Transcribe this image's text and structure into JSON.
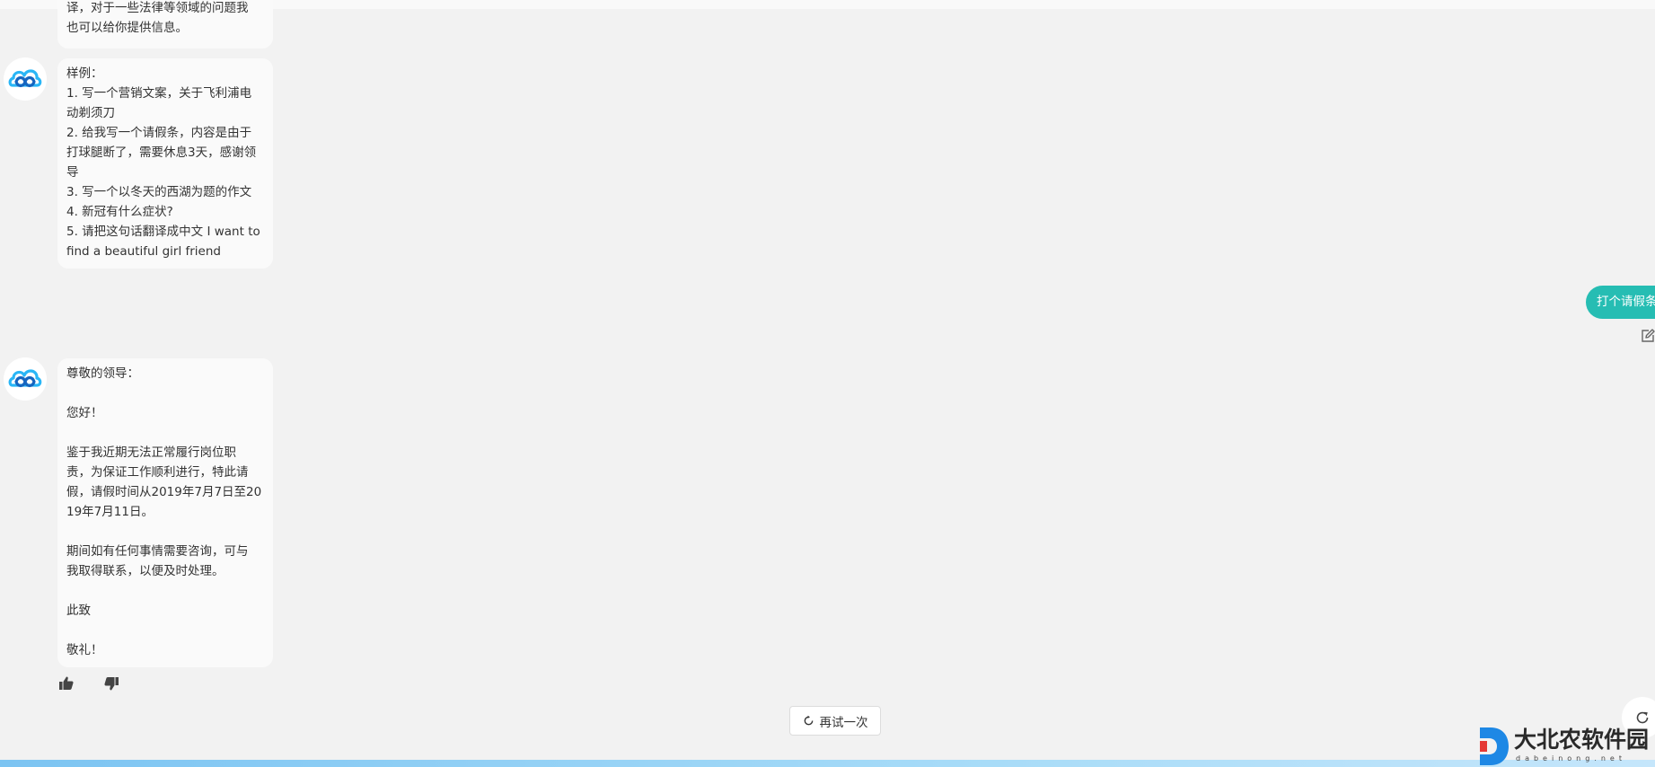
{
  "conversation": {
    "intro_message": {
      "lines": [
        "译，对于一些法律等领域的问题我",
        "也可以给你提供信息。"
      ]
    },
    "examples_message": {
      "lines": [
        "样例：",
        "1. 写一个营销文案，关于飞利浦电",
        "动剃须刀",
        "2. 给我写一个请假条，内容是由于",
        "打球腿断了，需要休息3天，感谢领",
        "导",
        "3. 写一个以冬天的西湖为题的作文",
        "4. 新冠有什么症状?",
        "5. 请把这句话翻译成中文 I want to",
        "find a beautiful girl friend"
      ]
    },
    "user_message": {
      "text": "打个请假条"
    },
    "reply_message": {
      "lines": [
        "尊敬的领导：",
        "",
        "您好！",
        "",
        "鉴于我近期无法正常履行岗位职",
        "责，为保证工作顺利进行，特此请",
        "假，请假时间从2019年7月7日至20",
        "19年7月11日。",
        "",
        "期间如有任何事情需要咨询，可与",
        "我取得联系，以便及时处理。",
        "",
        "此致",
        "",
        "敬礼！"
      ]
    }
  },
  "actions": {
    "retry_label": "再试一次"
  },
  "icons": {
    "avatar": "cloud-logo-icon",
    "like": "thumbs-up-icon",
    "dislike": "thumbs-down-icon",
    "edit": "edit-icon",
    "retry": "refresh-icon",
    "refresh": "refresh-icon"
  },
  "watermark": {
    "name": "大北农软件园",
    "sub": "dabeinong.net"
  },
  "colors": {
    "background": "#f2f2f2",
    "bot_bubble": "#fafafa",
    "user_bubble": "#26bdb3",
    "accent_blue": "#1e88e5"
  }
}
